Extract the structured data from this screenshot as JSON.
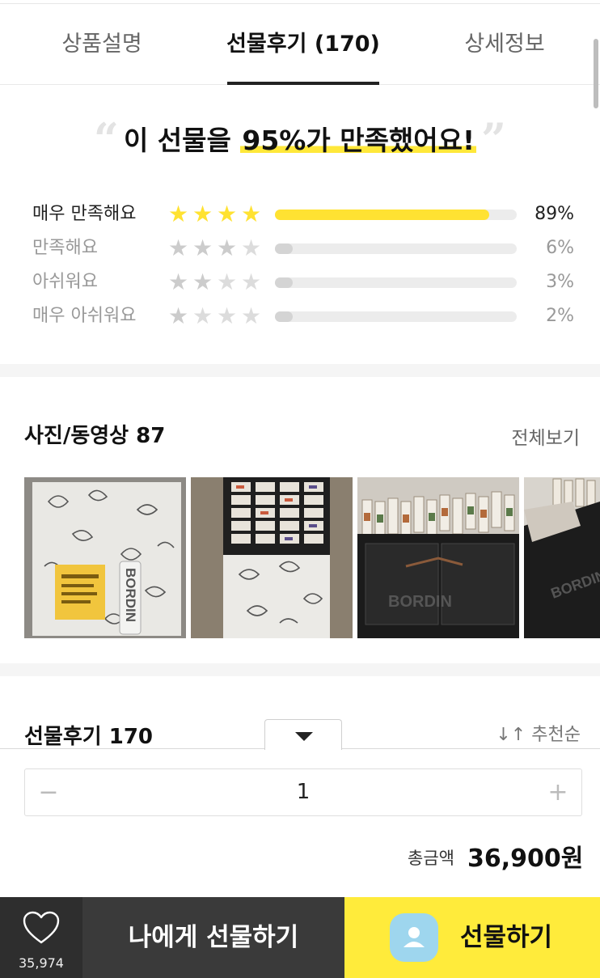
{
  "tabs": [
    {
      "label": "상품설명"
    },
    {
      "label": "선물후기 (170)"
    },
    {
      "label": "상세정보"
    }
  ],
  "headline": {
    "prefix": "이 선물을 ",
    "highlight": "95%가 만족했어요!",
    "open_quote": "“",
    "close_quote": "”"
  },
  "ratings": [
    {
      "label": "매우 만족해요",
      "stars": 4,
      "percent": 89,
      "percent_label": "89%"
    },
    {
      "label": "만족해요",
      "stars": 3,
      "percent": 6,
      "percent_label": "6%"
    },
    {
      "label": "아쉬워요",
      "stars": 2,
      "percent": 3,
      "percent_label": "3%"
    },
    {
      "label": "매우 아쉬워요",
      "stars": 1,
      "percent": 2,
      "percent_label": "2%"
    }
  ],
  "photos": {
    "title": "사진/동영상 87",
    "view_all": "전체보기",
    "brand_text": "BORDIN"
  },
  "reviews": {
    "title": "선물후기 170",
    "sort_label": "↓↑ 추천순"
  },
  "quantity": {
    "minus": "−",
    "value": "1",
    "plus": "+"
  },
  "total": {
    "label": "총금액",
    "amount": "36,900원"
  },
  "bottom_bar": {
    "wish_count": "35,974",
    "self_gift_label": "나에게 선물하기",
    "gift_label": "선물하기"
  },
  "colors": {
    "accent_yellow": "#ffe232",
    "gift_button": "#ffeb3b",
    "dark_button": "#3a3a3a"
  }
}
